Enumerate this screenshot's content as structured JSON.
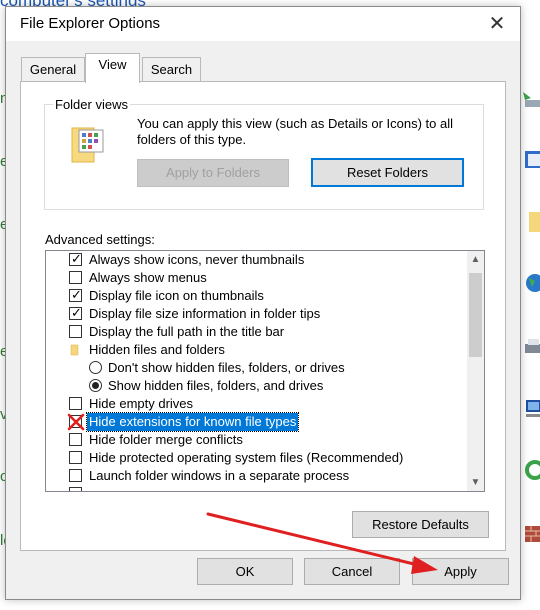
{
  "background": {
    "title": "computer's settings",
    "left_letters": [
      "n",
      "er",
      "e",
      "e",
      "ve",
      "ch",
      "le"
    ]
  },
  "dialog": {
    "title": "File Explorer Options",
    "close_glyph": "✕",
    "tabs": [
      {
        "label": "General"
      },
      {
        "label": "View"
      },
      {
        "label": "Search"
      }
    ],
    "folder_views": {
      "legend": "Folder views",
      "description": "You can apply this view (such as Details or Icons) to all folders of this type.",
      "apply_button": "Apply to Folders",
      "reset_button": "Reset Folders"
    },
    "advanced_label": "Advanced settings:",
    "advanced_items": [
      {
        "label": "Always show icons, never thumbnails",
        "type": "checkbox",
        "checked": true
      },
      {
        "label": "Always show menus",
        "type": "checkbox",
        "checked": false
      },
      {
        "label": "Display file icon on thumbnails",
        "type": "checkbox",
        "checked": true
      },
      {
        "label": "Display file size information in folder tips",
        "type": "checkbox",
        "checked": true
      },
      {
        "label": "Display the full path in the title bar",
        "type": "checkbox",
        "checked": false
      },
      {
        "label": "Hidden files and folders",
        "type": "folder"
      },
      {
        "label": "Don't show hidden files, folders, or drives",
        "type": "radio",
        "checked": false
      },
      {
        "label": "Show hidden files, folders, and drives",
        "type": "radio",
        "checked": true
      },
      {
        "label": "Hide empty drives",
        "type": "checkbox",
        "checked": false
      },
      {
        "label": "Hide extensions for known file types",
        "type": "checkbox",
        "checked": false,
        "selected": true,
        "annotated_x": true
      },
      {
        "label": "Hide folder merge conflicts",
        "type": "checkbox",
        "checked": false
      },
      {
        "label": "Hide protected operating system files (Recommended)",
        "type": "checkbox",
        "checked": false
      },
      {
        "label": "Launch folder windows in a separate process",
        "type": "checkbox",
        "checked": false
      }
    ],
    "restore_button": "Restore Defaults",
    "ok_button": "OK",
    "cancel_button": "Cancel",
    "apply_button": "Apply"
  },
  "colors": {
    "accent": "#0078d7",
    "annotation": "#e02020",
    "link_title": "#1a56b0"
  }
}
